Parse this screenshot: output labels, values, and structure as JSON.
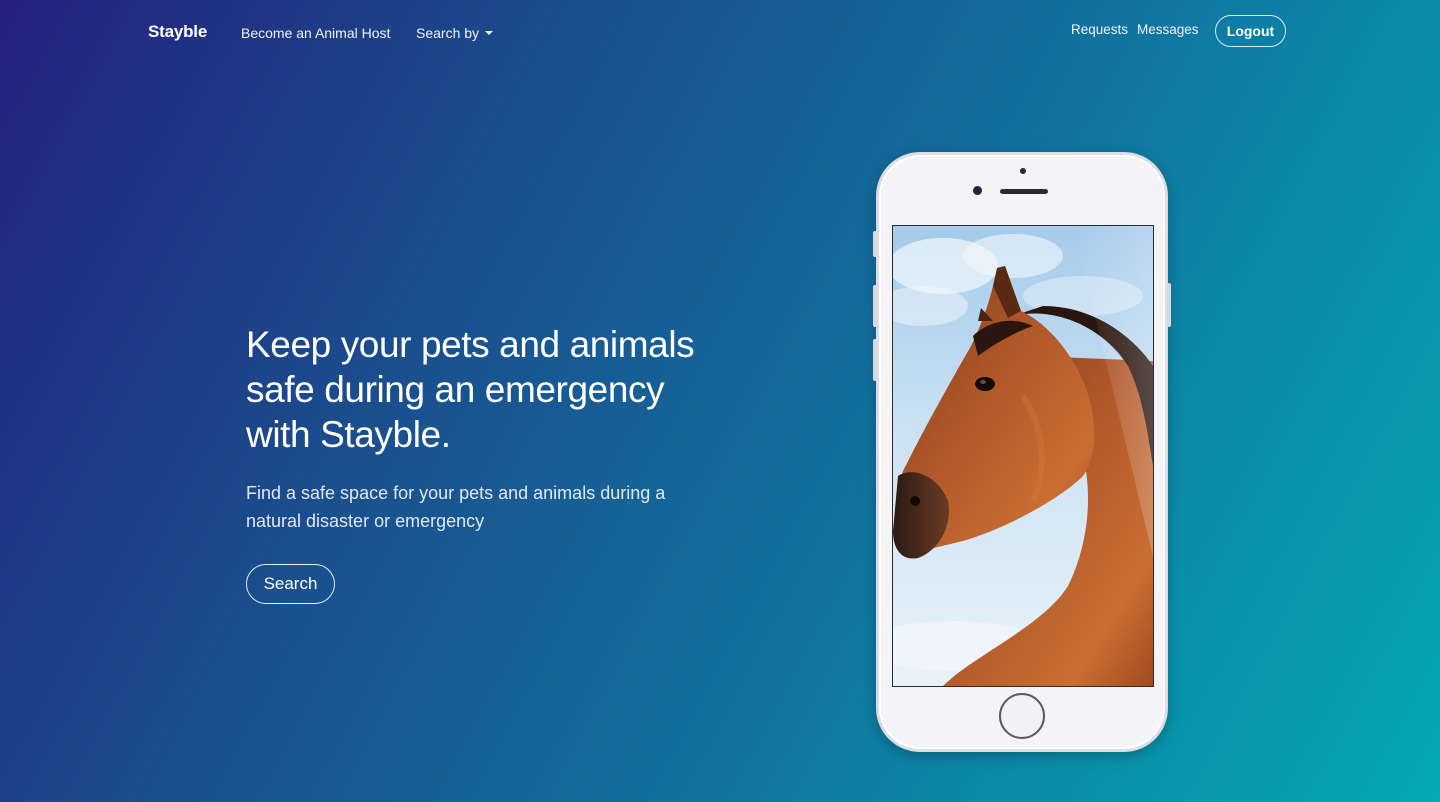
{
  "nav": {
    "brand": "Stayble",
    "become_host": "Become an Animal Host",
    "search_by": "Search by",
    "requests": "Requests",
    "messages": "Messages",
    "logout": "Logout"
  },
  "hero": {
    "title": "Keep your pets and animals safe during an emergency with Stayble.",
    "subtitle": "Find a safe space for your pets and animals during a natural disaster or emergency",
    "search_button": "Search"
  },
  "phone": {
    "screen_image": "horse-photo"
  },
  "colors": {
    "gradient_start": "#24217c",
    "gradient_end": "#05a8b4",
    "text": "#ffffff"
  }
}
